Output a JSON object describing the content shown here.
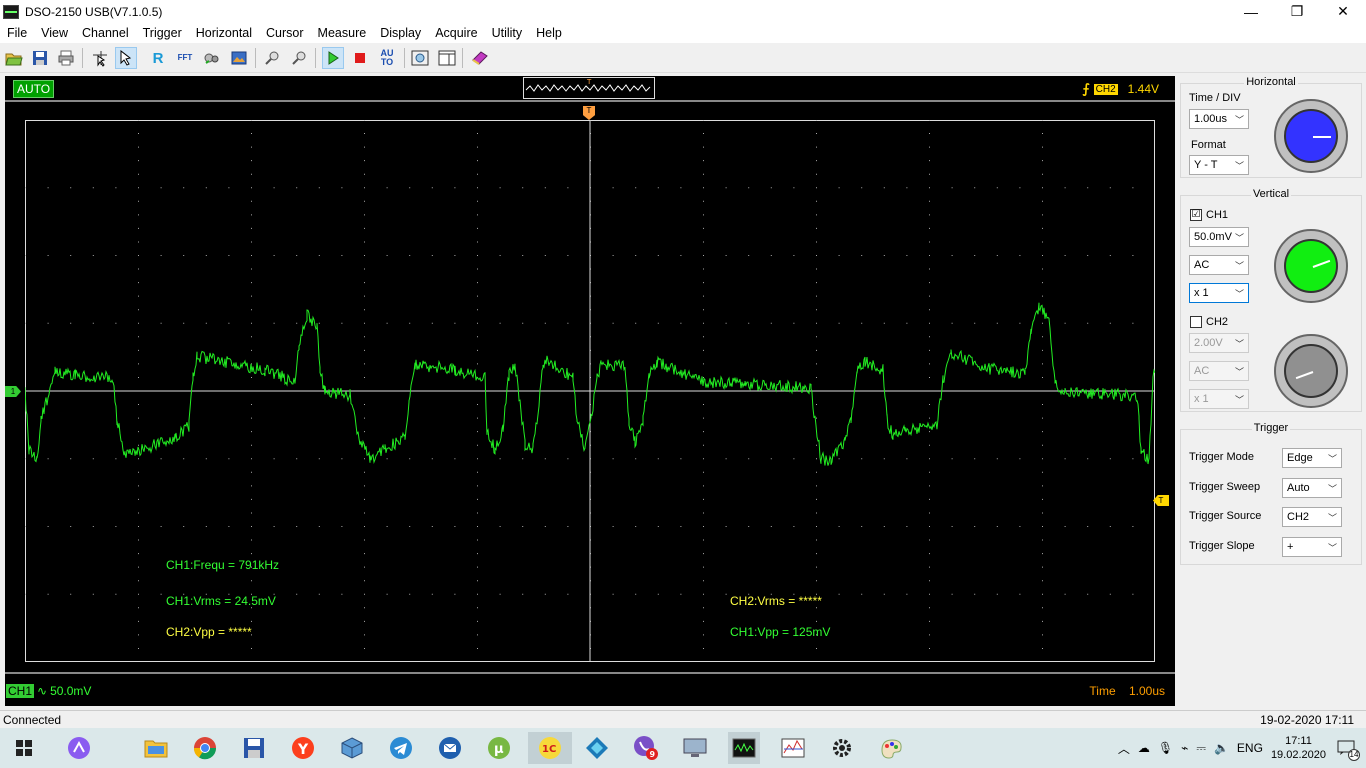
{
  "window": {
    "title": "DSO-2150 USB(V7.1.0.5)",
    "min": "—",
    "max": "❐",
    "close": "✕"
  },
  "menu": [
    "File",
    "View",
    "Channel",
    "Trigger",
    "Horizontal",
    "Cursor",
    "Measure",
    "Display",
    "Acquire",
    "Utility",
    "Help"
  ],
  "toolbar": {
    "items": [
      "open-icon",
      "save-icon",
      "print-icon",
      "cursor-cross-icon",
      "pointer-icon",
      "r-icon",
      "fft-icon",
      "probe-icon",
      "image-icon",
      "zoom-in-icon",
      "zoom-out-icon",
      "run-icon",
      "stop-icon",
      "auto-icon",
      "screenshot-icon",
      "layout-icon",
      "book-icon"
    ],
    "auto_label": "AU TO",
    "r_label": "R",
    "fft_label": "FFT"
  },
  "scope": {
    "mode": "AUTO",
    "trigger_channel": "CH2",
    "trigger_level": "1.44V",
    "trigger_marker": "T",
    "ch1_marker": "1",
    "measurements": {
      "ch1_freq": "CH1:Frequ = 791kHz",
      "ch1_vrms": "CH1:Vrms = 24.5mV",
      "ch2_vpp": "CH2:Vpp = *****",
      "ch2_vrms": "CH2:Vrms = *****",
      "ch1_vpp": "CH1:Vpp = 125mV"
    },
    "ch1_status": {
      "tag": "CH1",
      "coupling": "∿",
      "scale": "50.0mV"
    },
    "time_status": {
      "label": "Time",
      "value": "1.00us"
    }
  },
  "panel": {
    "horizontal": {
      "title": "Horizontal",
      "time_div_label": "Time / DIV",
      "time_div_value": "1.00us",
      "format_label": "Format",
      "format_value": "Y - T",
      "knob_color": "#3333ff"
    },
    "vertical": {
      "title": "Vertical",
      "ch1": {
        "label": "CH1",
        "checked": "☑",
        "volts": "50.0mV",
        "coupling": "AC",
        "probe": "x 1",
        "knob_color": "#11ee11"
      },
      "ch2": {
        "label": "CH2",
        "volts": "2.00V",
        "coupling": "AC",
        "probe": "x 1",
        "knob_color": "#909090"
      }
    },
    "trigger": {
      "title": "Trigger",
      "mode_label": "Trigger Mode",
      "mode_value": "Edge",
      "sweep_label": "Trigger Sweep",
      "sweep_value": "Auto",
      "source_label": "Trigger Source",
      "source_value": "CH2",
      "slope_label": "Trigger Slope",
      "slope_value": "+"
    }
  },
  "statusbar": {
    "left": "Connected",
    "right": "19-02-2020  17:11"
  },
  "taskbar": {
    "apps": [
      "windows-icon",
      "alice-icon",
      "explorer-icon",
      "chrome-icon",
      "save-icon",
      "yandex-icon",
      "box-icon",
      "telegram-icon",
      "mail-icon",
      "utorrent-icon",
      "1c-icon",
      "diamond-icon",
      "viber-icon",
      "monitor-icon",
      "oscilloscope-icon",
      "chart-icon",
      "gear-icon",
      "paint-icon"
    ],
    "viber_badge": "9",
    "lang": "ENG",
    "time": "17:11",
    "date": "19.02.2020",
    "notif_count": "14"
  }
}
